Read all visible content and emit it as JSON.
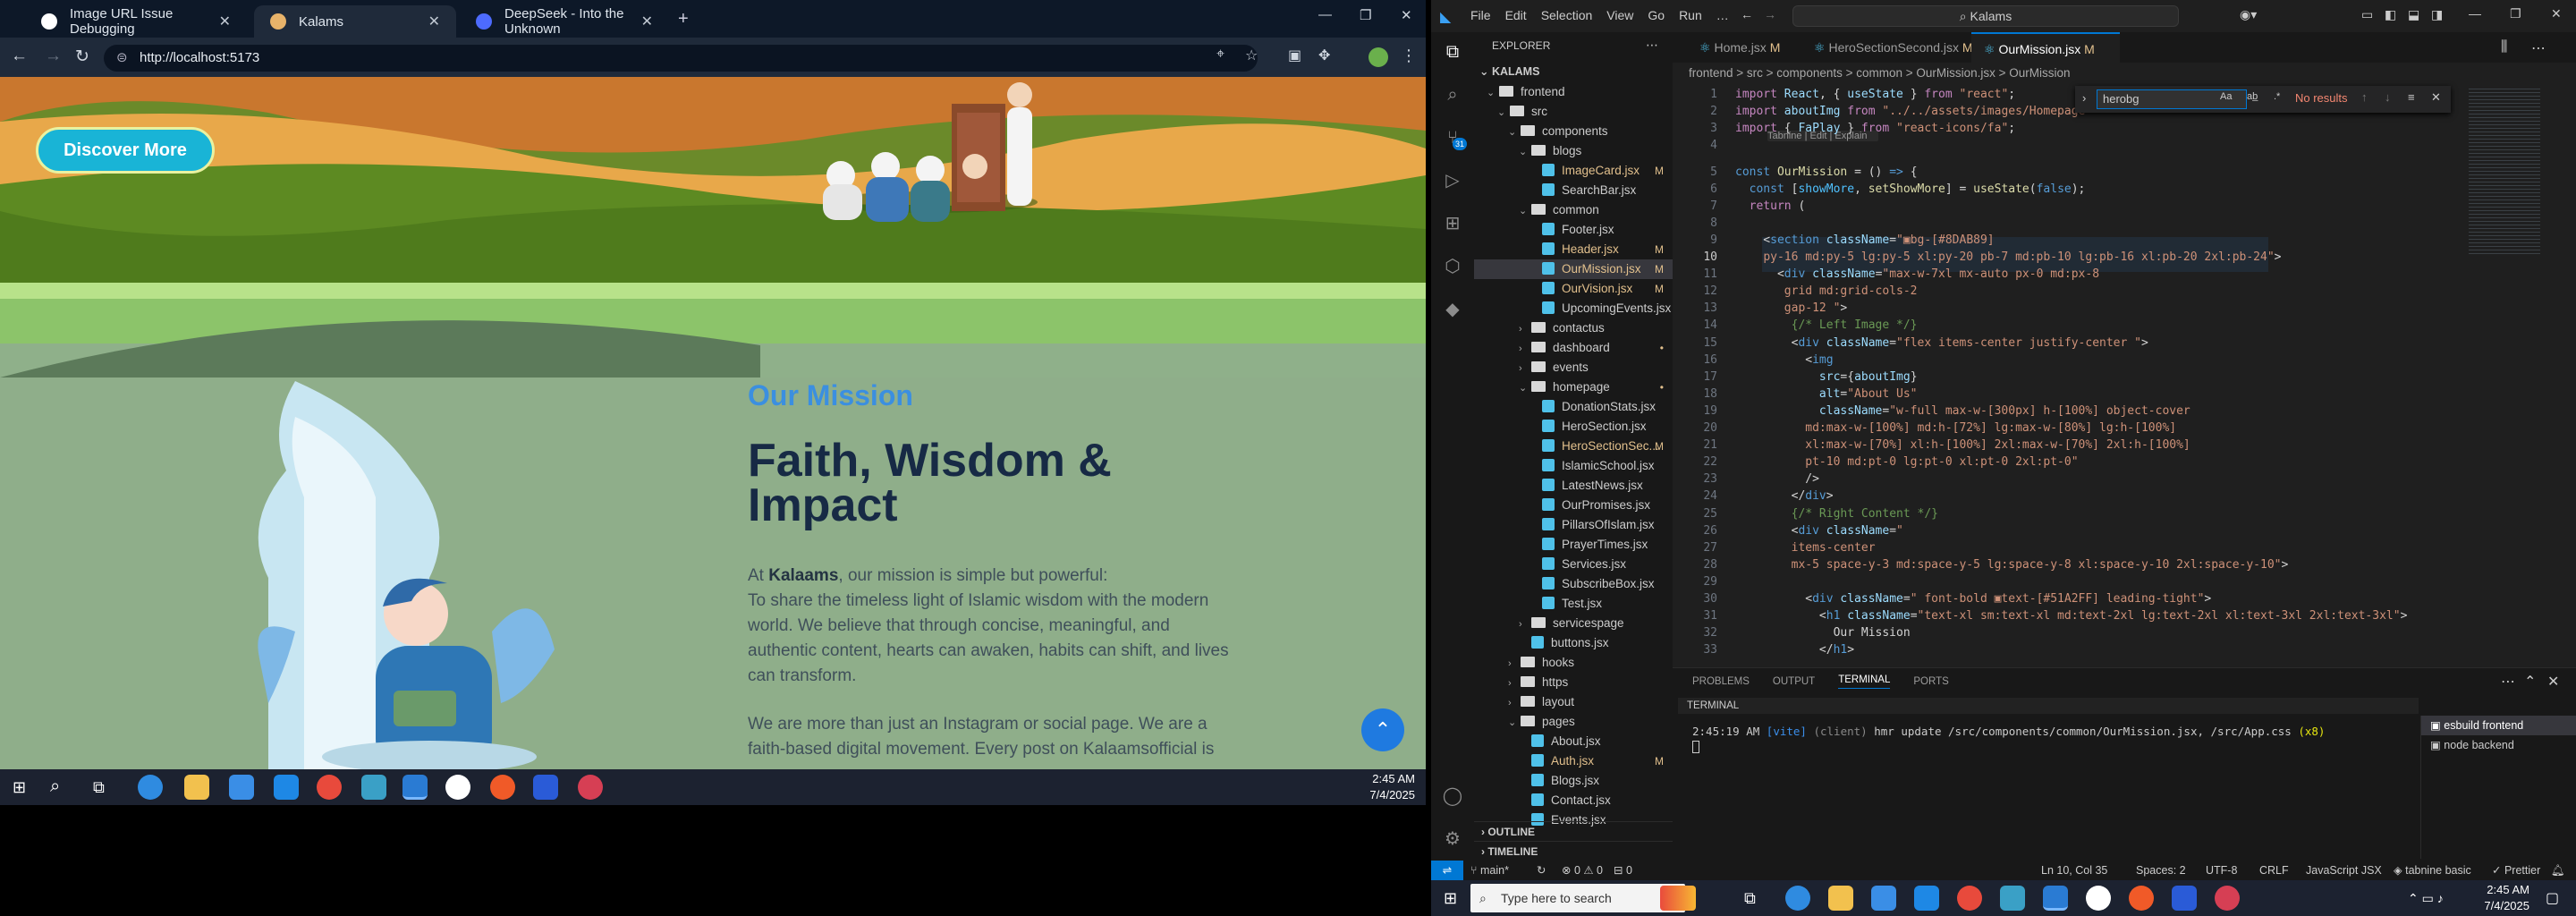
{
  "browser": {
    "tabs": [
      {
        "label": "Image URL Issue Debugging",
        "favicon_color": "#ffffff"
      },
      {
        "label": "Kalams",
        "favicon_color": "#e8b36a"
      },
      {
        "label": "DeepSeek - Into the Unknown",
        "favicon_color": "#4d6bfe"
      }
    ],
    "new_tab": "+",
    "url": "http://localhost:5173",
    "window_controls": {
      "min": "—",
      "max": "❐",
      "close": "✕"
    }
  },
  "website": {
    "discover_button": "Discover More",
    "section_tag": "Our Mission",
    "heading_line1": "Faith, Wisdom &",
    "heading_line2": "Impact",
    "intro_prefix": "At ",
    "intro_brand": "Kalaams",
    "intro_suffix": ", our mission is simple but powerful:",
    "paragraph1": "To share the timeless light of Islamic wisdom with the modern world. We believe that through concise, meaningful, and authentic content, hearts can awaken, habits can shift, and lives can transform.",
    "paragraph2": "We are more than just an Instagram or social page. We are a faith-based digital movement. Every post on Kalaamsofficial is",
    "scroll_top_icon": "chevron-up-icon"
  },
  "taskbar_left": {
    "time": "2:45 AM",
    "date": "7/4/2025"
  },
  "vscode": {
    "menu": [
      "File",
      "Edit",
      "Selection",
      "View",
      "Go",
      "Run",
      "…"
    ],
    "search": "Kalams",
    "explorer_title": "EXPLORER",
    "root": "KALAMS",
    "tree": [
      {
        "label": "frontend",
        "type": "folder",
        "depth": 1,
        "open": true
      },
      {
        "label": "src",
        "type": "folder",
        "depth": 2,
        "open": true
      },
      {
        "label": "components",
        "type": "folder",
        "depth": 3,
        "open": true
      },
      {
        "label": "blogs",
        "type": "folder",
        "depth": 4,
        "open": true
      },
      {
        "label": "ImageCard.jsx",
        "type": "file",
        "depth": 5,
        "mark": "M"
      },
      {
        "label": "SearchBar.jsx",
        "type": "file",
        "depth": 5
      },
      {
        "label": "common",
        "type": "folder",
        "depth": 4,
        "open": true
      },
      {
        "label": "Footer.jsx",
        "type": "file",
        "depth": 5
      },
      {
        "label": "Header.jsx",
        "type": "file",
        "depth": 5,
        "mark": "M"
      },
      {
        "label": "OurMission.jsx",
        "type": "file",
        "depth": 5,
        "mark": "M",
        "selected": true
      },
      {
        "label": "OurVision.jsx",
        "type": "file",
        "depth": 5,
        "mark": "M"
      },
      {
        "label": "UpcomingEvents.jsx",
        "type": "file",
        "depth": 5
      },
      {
        "label": "contactus",
        "type": "folder",
        "depth": 4
      },
      {
        "label": "dashboard",
        "type": "folder",
        "depth": 4,
        "mark": "•"
      },
      {
        "label": "events",
        "type": "folder",
        "depth": 4
      },
      {
        "label": "homepage",
        "type": "folder",
        "depth": 4,
        "open": true,
        "mark": "•"
      },
      {
        "label": "DonationStats.jsx",
        "type": "file",
        "depth": 5
      },
      {
        "label": "HeroSection.jsx",
        "type": "file",
        "depth": 5
      },
      {
        "label": "HeroSectionSec...",
        "type": "file",
        "depth": 5,
        "mark": "M"
      },
      {
        "label": "IslamicSchool.jsx",
        "type": "file",
        "depth": 5
      },
      {
        "label": "LatestNews.jsx",
        "type": "file",
        "depth": 5
      },
      {
        "label": "OurPromises.jsx",
        "type": "file",
        "depth": 5
      },
      {
        "label": "PillarsOfIslam.jsx",
        "type": "file",
        "depth": 5
      },
      {
        "label": "PrayerTimes.jsx",
        "type": "file",
        "depth": 5
      },
      {
        "label": "Services.jsx",
        "type": "file",
        "depth": 5
      },
      {
        "label": "SubscribeBox.jsx",
        "type": "file",
        "depth": 5
      },
      {
        "label": "Test.jsx",
        "type": "file",
        "depth": 5
      },
      {
        "label": "servicespage",
        "type": "folder",
        "depth": 4
      },
      {
        "label": "buttons.jsx",
        "type": "file",
        "depth": 4
      },
      {
        "label": "hooks",
        "type": "folder",
        "depth": 3
      },
      {
        "label": "https",
        "type": "folder",
        "depth": 3
      },
      {
        "label": "layout",
        "type": "folder",
        "depth": 3
      },
      {
        "label": "pages",
        "type": "folder",
        "depth": 3,
        "open": true
      },
      {
        "label": "About.jsx",
        "type": "file",
        "depth": 4
      },
      {
        "label": "Auth.jsx",
        "type": "file",
        "depth": 4,
        "mark": "M"
      },
      {
        "label": "Blogs.jsx",
        "type": "file",
        "depth": 4
      },
      {
        "label": "Contact.jsx",
        "type": "file",
        "depth": 4
      },
      {
        "label": "Events.jsx",
        "type": "file",
        "depth": 4
      }
    ],
    "outline": "OUTLINE",
    "timeline": "TIMELINE",
    "editor_tabs": [
      {
        "label": "Home.jsx",
        "mark": "M"
      },
      {
        "label": "HeroSectionSecond.jsx",
        "mark": "M"
      },
      {
        "label": "OurMission.jsx",
        "mark": "M",
        "active": true
      }
    ],
    "breadcrumb": "frontend > src > components > common > OurMission.jsx > OurMission",
    "find": {
      "query": "herobg",
      "result": "No results"
    },
    "codelens": "Tabnine | Edit | Explain",
    "panel_tabs": [
      "PROBLEMS",
      "OUTPUT",
      "TERMINAL",
      "PORTS"
    ],
    "terminal_title": "TERMINAL",
    "terminal_line": {
      "time": "2:45:19 AM",
      "tool": "[vite]",
      "client": "(client)",
      "msg": "hmr update /src/components/common/OurMission.jsx, /src/App.css",
      "count": "(x8)"
    },
    "terminals": [
      "esbuild frontend",
      "node backend"
    ],
    "status": {
      "branch": "main*",
      "errors": "⊗ 0 ⚠ 0",
      "ports": "0",
      "position": "Ln 10, Col 35",
      "spaces": "Spaces: 2",
      "encoding": "UTF-8",
      "eol": "CRLF",
      "language": "JavaScript JSX",
      "tabnine": "tabnine basic",
      "prettier": "✓ Prettier"
    }
  },
  "taskbar_right": {
    "search_placeholder": "Type here to search",
    "time": "2:45 AM",
    "date": "7/4/2025"
  }
}
